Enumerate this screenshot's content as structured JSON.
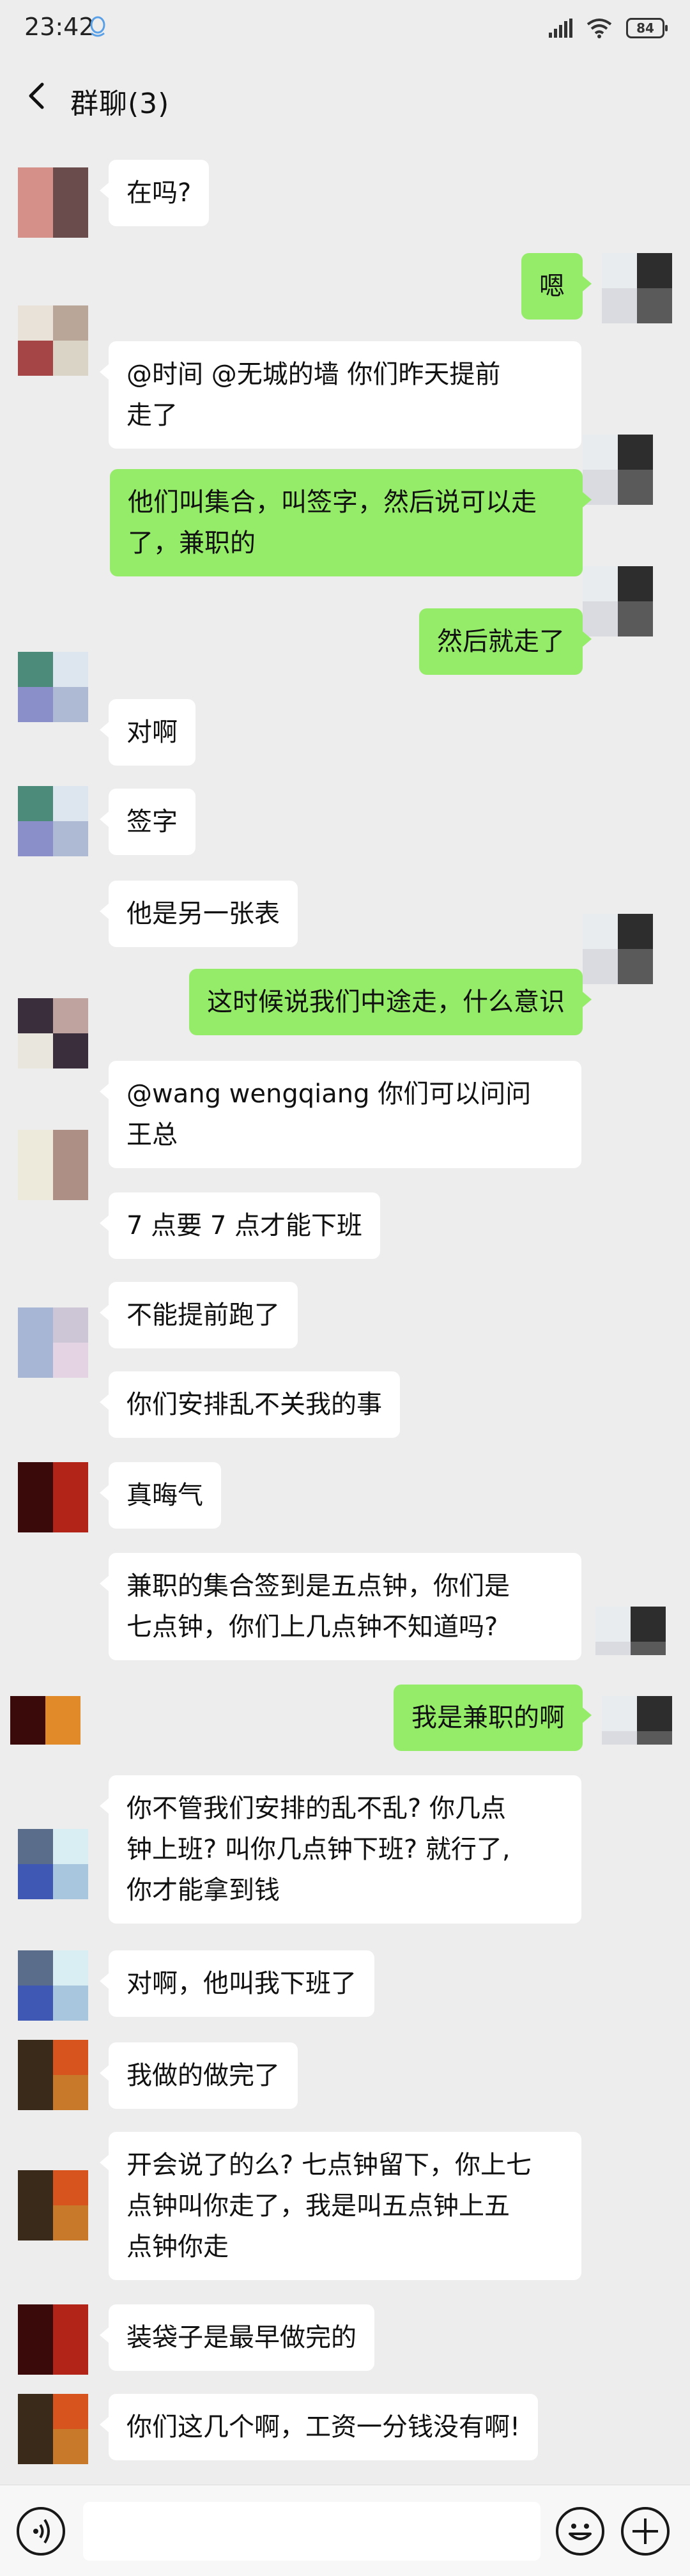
{
  "status_bar": {
    "time": "23:42",
    "battery": "84",
    "qq_icon": "qq-penguin-icon",
    "signal_icon": "signal-bars-icon",
    "wifi_icon": "wifi-icon"
  },
  "header": {
    "title": "群聊(3)",
    "back_icon": "chevron-left-icon"
  },
  "messages": [
    {
      "side": "left",
      "text": "在吗?"
    },
    {
      "side": "right",
      "text": "嗯"
    },
    {
      "side": "left",
      "text": "@时间 @无城的墙 你们昨天提前\n走了"
    },
    {
      "side": "right",
      "text": "他们叫集合，叫签字，然后说可以走\n了，兼职的"
    },
    {
      "side": "right",
      "text": "然后就走了"
    },
    {
      "side": "left",
      "text": "对啊"
    },
    {
      "side": "left",
      "text": "签字"
    },
    {
      "side": "left",
      "text": "他是另一张表"
    },
    {
      "side": "right",
      "text": "这时候说我们中途走，什么意识"
    },
    {
      "side": "left",
      "text": "@wang wengqiang 你们可以问问\n王总"
    },
    {
      "side": "left",
      "text": "7 点要 7 点才能下班"
    },
    {
      "side": "left",
      "text": "不能提前跑了"
    },
    {
      "side": "left",
      "text": "你们安排乱不关我的事"
    },
    {
      "side": "left",
      "text": "真晦气"
    },
    {
      "side": "left",
      "text": "兼职的集合签到是五点钟，你们是\n七点钟，你们上几点钟不知道吗?"
    },
    {
      "side": "right",
      "text": "我是兼职的啊"
    },
    {
      "side": "left",
      "text": "你不管我们安排的乱不乱? 你几点\n钟上班? 叫你几点钟下班? 就行了,\n你才能拿到钱"
    },
    {
      "side": "left",
      "text": "对啊，他叫我下班了"
    },
    {
      "side": "left",
      "text": "我做的做完了"
    },
    {
      "side": "left",
      "text": "开会说了的么? 七点钟留下，你上七\n点钟叫你走了，我是叫五点钟上五\n点钟你走"
    },
    {
      "side": "left",
      "text": "装袋子是最早做完的"
    },
    {
      "side": "left",
      "text": "你们这几个啊，工资一分钱没有啊!"
    }
  ],
  "avatar_colors": {
    "a1": [
      "#d49089",
      "#6b4c4c",
      "#d49089",
      "#6b4c4c"
    ],
    "me": [
      "#e9ecef",
      "#2d2d2d",
      "#d9dbe0",
      "#5a5a5a"
    ],
    "a2": [
      "#e8e2d8",
      "#b9a699",
      "#a64545",
      "#d9d4c6"
    ],
    "a3": [
      "#4c8a7a",
      "#dde6ee",
      "#8a8fc9",
      "#aebad4"
    ],
    "a4": [
      "#3a2e3c",
      "#bfa39f",
      "#e9e6dd",
      "#3a2e3c"
    ],
    "a5": [
      "#ede9db",
      "#ae8f86",
      "#ede9db",
      "#ae8f86"
    ],
    "a6": [
      "#a6b6d4",
      "#cdc6d6",
      "#a6b6d4",
      "#e3d3e3"
    ],
    "a7": [
      "#3a0a0a",
      "#b22418",
      "#3a0a0a",
      "#b22418"
    ],
    "a8": [
      "#3a0a0a",
      "#e08a2a",
      "#3a0a0a",
      "#e08a2a"
    ],
    "a9": [
      "#5a6d8a",
      "#d9eef2",
      "#3f58b4",
      "#a8c7de"
    ],
    "a10": [
      "#3a2a1a",
      "#d8541e",
      "#3a2a1a",
      "#c87a2a"
    ]
  },
  "input_bar": {
    "placeholder": "",
    "voice_icon": "voice-icon",
    "emoji_icon": "emoji-icon",
    "plus_icon": "plus-icon"
  }
}
